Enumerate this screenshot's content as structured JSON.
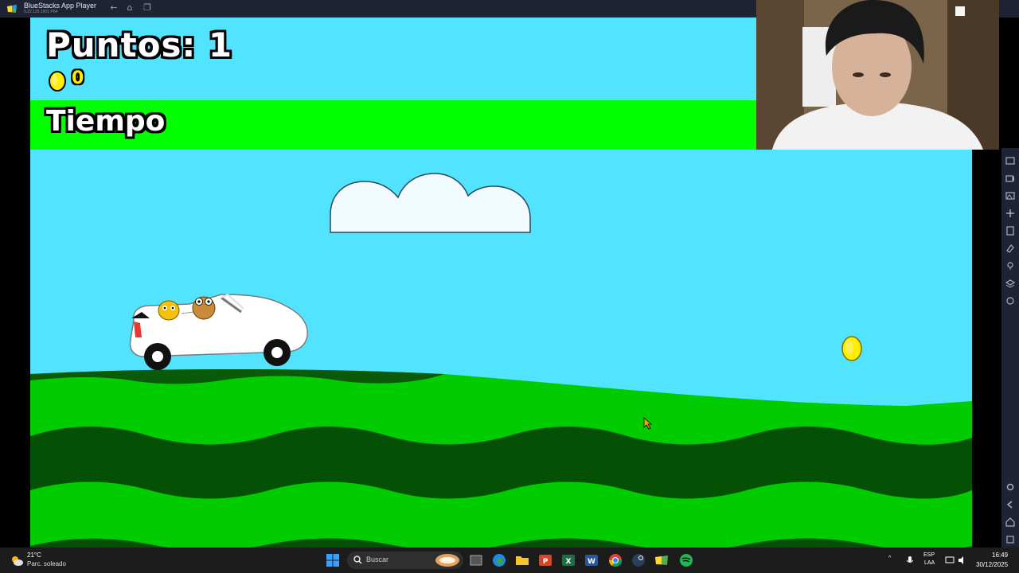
{
  "window": {
    "title": "BlueStacks App Player",
    "version": "5.22.125.1001 P64"
  },
  "hud": {
    "score_text": "Puntos: 1",
    "coins": "0",
    "time_label": "Tiempo"
  },
  "colors": {
    "sky": "#52e3ff",
    "grass_light": "#00cc00",
    "grass_dark": "#006400",
    "time_bar": "#00ff00",
    "coin": "#ffee00"
  },
  "taskbar": {
    "weather_temp": "21°C",
    "weather_desc": "Parc. soleado",
    "search_placeholder": "Buscar",
    "lang_top": "ESP",
    "lang_bottom": "LAA",
    "time": "16:49",
    "date": "30/12/2025"
  },
  "icons": {
    "title_left": [
      "back-arrow-icon",
      "home-icon",
      "multitask-icon"
    ],
    "side_toolbar": [
      "screenshot-icon",
      "record-icon",
      "media-icon",
      "controls-icon",
      "apk-icon",
      "erase-icon",
      "location-icon",
      "layers-icon",
      "sync-icon",
      "settings-icon",
      "back-icon",
      "home-icon",
      "recents-icon"
    ],
    "taskbar_apps": [
      "file-explorer-icon",
      "edge-icon",
      "folder-icon",
      "powerpoint-icon",
      "excel-icon",
      "word-icon",
      "chrome-icon",
      "steam-icon",
      "bluestacks-icon",
      "spotify-icon"
    ]
  }
}
